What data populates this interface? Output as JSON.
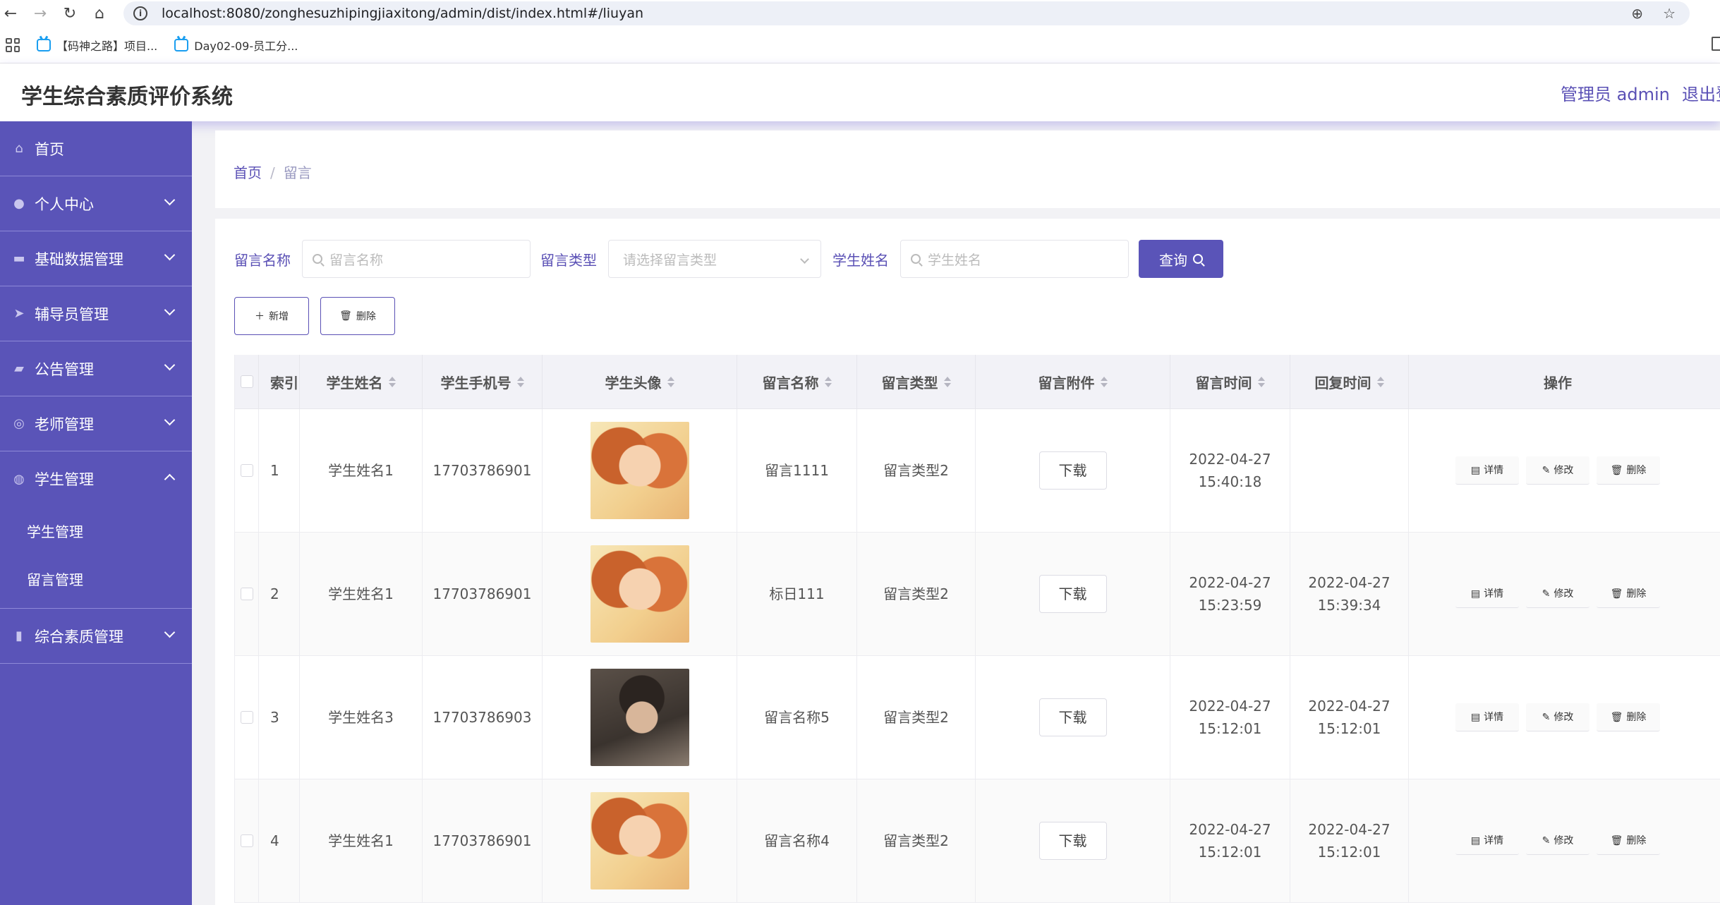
{
  "browser": {
    "url": "localhost:8080/zonghesuzhipingjiaxitong/admin/dist/index.html#/liuyan",
    "bookmarks": [
      "【码神之路】项目...",
      "Day02-09-员工分..."
    ]
  },
  "header": {
    "title": "学生综合素质评价系统",
    "admin_label": "管理员 admin",
    "logout_label": "退出登"
  },
  "sidebar": {
    "items": [
      {
        "label": "首页",
        "icon": "home-icon"
      },
      {
        "label": "个人中心",
        "icon": "user-icon"
      },
      {
        "label": "基础数据管理",
        "icon": "chat-icon"
      },
      {
        "label": "辅导员管理",
        "icon": "send-icon"
      },
      {
        "label": "公告管理",
        "icon": "ticket-icon"
      },
      {
        "label": "老师管理",
        "icon": "settings-icon"
      },
      {
        "label": "学生管理",
        "icon": "palette-icon"
      },
      {
        "label": "综合素质管理",
        "icon": "chart-icon"
      }
    ],
    "sub_items": [
      "学生管理",
      "留言管理"
    ]
  },
  "breadcrumb": {
    "home": "首页",
    "separator": "/",
    "current": "留言"
  },
  "search": {
    "name_label": "留言名称",
    "name_placeholder": "留言名称",
    "type_label": "留言类型",
    "type_placeholder": "请选择留言类型",
    "student_label": "学生姓名",
    "student_placeholder": "学生姓名",
    "query_label": "查询"
  },
  "actions": {
    "add_label": "新增",
    "delete_label": "删除"
  },
  "table": {
    "headers": [
      "索引",
      "学生姓名",
      "学生手机号",
      "学生头像",
      "留言名称",
      "留言类型",
      "留言附件",
      "留言时间",
      "回复时间",
      "操作"
    ],
    "download_label": "下载",
    "op_labels": {
      "detail": "详情",
      "edit": "修改",
      "delete": "删除"
    },
    "rows": [
      {
        "index": "1",
        "name": "学生姓名1",
        "phone": "17703786901",
        "avatar": "girl",
        "title": "留言1111",
        "type": "留言类型2",
        "time": "2022-04-27 15:40:18",
        "reply_time": ""
      },
      {
        "index": "2",
        "name": "学生姓名1",
        "phone": "17703786901",
        "avatar": "girl",
        "title": "标日111",
        "type": "留言类型2",
        "time": "2022-04-27 15:23:59",
        "reply_time": "2022-04-27 15:39:34"
      },
      {
        "index": "3",
        "name": "学生姓名3",
        "phone": "17703786903",
        "avatar": "boy",
        "title": "留言名称5",
        "type": "留言类型2",
        "time": "2022-04-27 15:12:01",
        "reply_time": "2022-04-27 15:12:01"
      },
      {
        "index": "4",
        "name": "学生姓名1",
        "phone": "17703786901",
        "avatar": "girl",
        "title": "留言名称4",
        "type": "留言类型2",
        "time": "2022-04-27 15:12:01",
        "reply_time": "2022-04-27 15:12:01"
      }
    ]
  },
  "colors": {
    "primary": "#5a54b8",
    "link": "#5a50b5"
  }
}
